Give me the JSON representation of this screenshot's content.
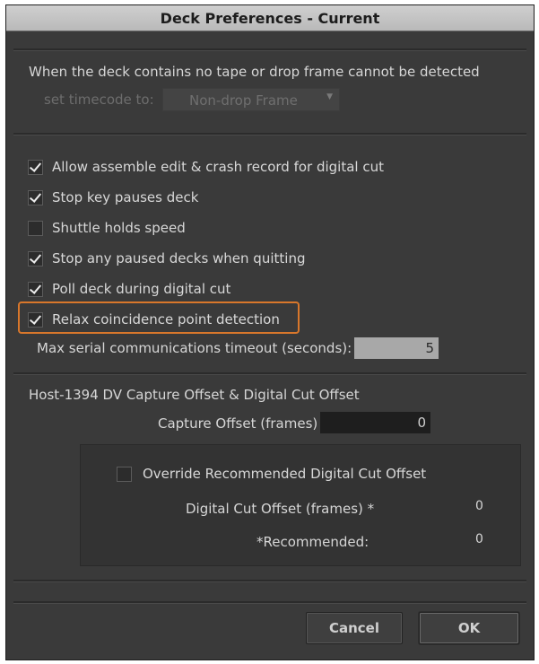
{
  "dialog": {
    "title": "Deck Preferences - Current"
  },
  "timecode": {
    "description": "When the deck contains no tape or drop frame cannot be detected",
    "label": "set timecode to:",
    "value": "Non-drop Frame"
  },
  "options": [
    {
      "label": "Allow assemble edit & crash record for digital cut",
      "checked": true
    },
    {
      "label": "Stop key pauses deck",
      "checked": true
    },
    {
      "label": "Shuttle holds speed",
      "checked": false
    },
    {
      "label": "Stop any paused decks when quitting",
      "checked": true
    },
    {
      "label": "Poll deck during digital cut",
      "checked": true
    },
    {
      "label": "Relax coincidence point detection",
      "checked": true
    }
  ],
  "serial_timeout": {
    "label": "Max serial communications timeout (seconds):",
    "value": "5"
  },
  "dv_offset": {
    "heading": "Host-1394 DV Capture Offset & Digital Cut Offset",
    "capture_label": "Capture Offset (frames)",
    "capture_value": "0",
    "override_label": "Override Recommended Digital Cut Offset",
    "override_checked": false,
    "digital_cut_label": "Digital Cut Offset (frames) *",
    "digital_cut_value": "0",
    "recommended_label": "*Recommended:",
    "recommended_value": "0"
  },
  "buttons": {
    "cancel": "Cancel",
    "ok": "OK"
  },
  "colors": {
    "highlight": "#d9772b",
    "panel": "#3a3a3a"
  }
}
